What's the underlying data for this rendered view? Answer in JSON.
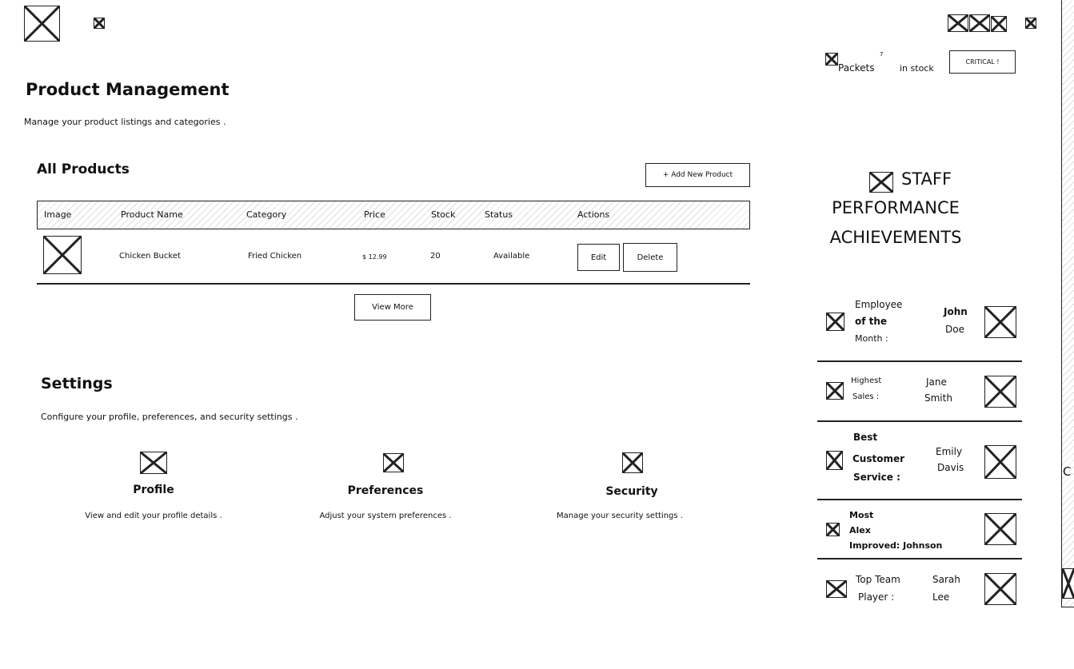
{
  "header": {
    "logo_icon": "logo-icon",
    "nav_icon": "menu-icon",
    "right_icons": [
      "notification-icon",
      "message-icon",
      "cart-icon",
      "profile-icon"
    ]
  },
  "page": {
    "title": "Product Management",
    "subtitle": "Manage your product listings and categories ."
  },
  "products": {
    "section_title": "All Products",
    "add_button": "+ Add New Product",
    "columns": [
      "Image",
      "Product Name",
      "Category",
      "Price",
      "Stock",
      "Status",
      "Actions"
    ],
    "rows": [
      {
        "image_icon": "product-image",
        "name": "Chicken Bucket",
        "category": "Fried Chicken",
        "price": "$ 12.99",
        "stock": "20",
        "status": "Available",
        "edit_label": "Edit",
        "delete_label": "Delete"
      }
    ],
    "view_more": "View More"
  },
  "settings": {
    "title": "Settings",
    "subtitle": "Configure your profile, preferences, and security settings .",
    "cards": [
      {
        "icon": "profile-icon",
        "title": "Profile",
        "desc": "View and edit your profile details ."
      },
      {
        "icon": "preferences-icon",
        "title": "Preferences",
        "desc": "Adjust your system preferences ."
      },
      {
        "icon": "security-icon",
        "title": "Security",
        "desc": "Manage your security settings ."
      }
    ]
  },
  "stock_alert": {
    "item": "Packets",
    "count": "7",
    "in_stock": "in stock",
    "badge": "CRITICAL !"
  },
  "staff": {
    "title_line1": "STAFF",
    "title_line2": "PERFORMANCE",
    "title_line3": "ACHIEVEMENTS",
    "achievements": [
      {
        "label_lines": [
          "Employee",
          "of the",
          "Month :"
        ],
        "name_lines": [
          "John",
          "Doe"
        ]
      },
      {
        "label_lines": [
          "Highest",
          "Sales :"
        ],
        "name_lines": [
          "Jane",
          "Smith"
        ]
      },
      {
        "label_lines": [
          "Best",
          "Customer",
          "Service :"
        ],
        "name_lines": [
          "Emily",
          "Davis"
        ]
      },
      {
        "label_lines": [
          "Most",
          "Alex",
          "Improved: Johnson"
        ],
        "name_lines": [
          "",
          ""
        ]
      },
      {
        "label_lines": [
          "Top Team",
          "Player :"
        ],
        "name_lines": [
          "Sarah",
          "Lee"
        ]
      }
    ]
  },
  "edge": {
    "letter": "C"
  }
}
